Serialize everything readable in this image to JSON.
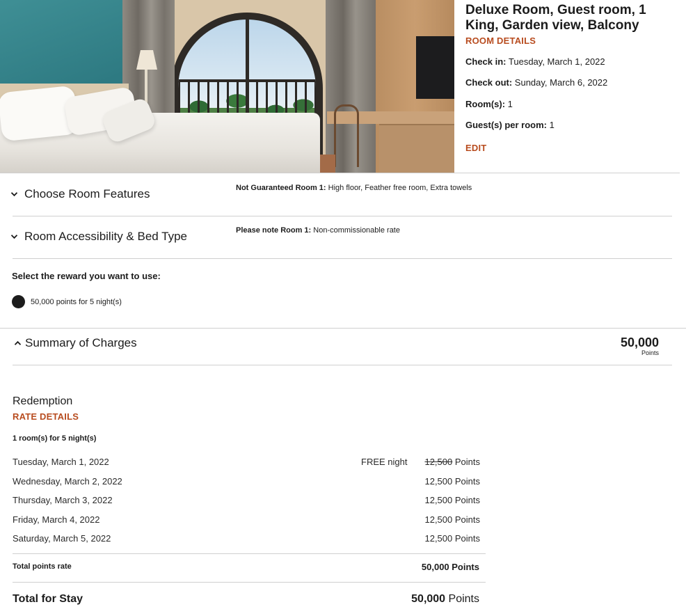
{
  "room": {
    "title": "Deluxe Room, Guest room, 1 King, Garden view, Balcony",
    "details_link": "ROOM DETAILS",
    "check_in_label": "Check in:",
    "check_in_value": "Tuesday, March 1, 2022",
    "check_out_label": "Check out:",
    "check_out_value": "Sunday, March 6, 2022",
    "rooms_label": "Room(s):",
    "rooms_value": "1",
    "guests_label": "Guest(s) per room:",
    "guests_value": "1",
    "edit_link": "EDIT"
  },
  "sections": {
    "features_label": "Choose Room Features",
    "accessibility_label": "Room Accessibility & Bed Type",
    "features_note_label": "Not Guaranteed Room 1:",
    "features_note_value": "High floor, Feather free room, Extra towels",
    "accessibility_note_label": "Please note Room 1:",
    "accessibility_note_value": "Non-commissionable rate"
  },
  "reward": {
    "title": "Select the reward you want to use:",
    "option_label": "50,000 points for 5 night(s)",
    "selected": true
  },
  "summary": {
    "label": "Summary of Charges",
    "total": "50,000",
    "total_unit": "Points"
  },
  "redemption": {
    "title": "Redemption",
    "rate_details_link": "RATE DETAILS",
    "rooms_nights": "1 room(s) for 5 night(s)",
    "nights": [
      {
        "date": "Tuesday, March 1, 2022",
        "free_label": "FREE night",
        "original_points": "12,500",
        "points": "Points"
      },
      {
        "date": "Wednesday, March 2, 2022",
        "points": "12,500 Points"
      },
      {
        "date": "Thursday, March 3, 2022",
        "points": "12,500 Points"
      },
      {
        "date": "Friday, March 4, 2022",
        "points": "12,500 Points"
      },
      {
        "date": "Saturday, March 5, 2022",
        "points": "12,500 Points"
      }
    ],
    "total_points_rate_label": "Total points rate",
    "total_points_rate_value": "50,000 Points",
    "total_for_stay_label": "Total for Stay",
    "total_for_stay_number": "50,000",
    "total_for_stay_unit": "Points"
  },
  "colors": {
    "accent": "#b84c1f",
    "text": "#1c1c1c",
    "divider": "#cfcfcf"
  },
  "icons": {
    "collapse_features": "chevron-down-icon",
    "collapse_accessibility": "chevron-down-icon",
    "summary_toggle": "chevron-up-icon"
  }
}
